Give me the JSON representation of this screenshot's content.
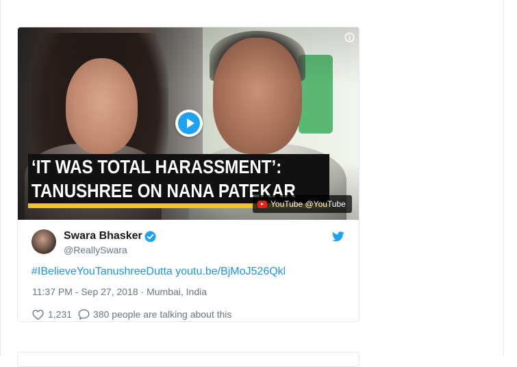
{
  "video": {
    "headline_line1": "‘IT WAS TOTAL HARASSMENT’:",
    "headline_line2": "TANUSHREE ON NANA PATEKAR",
    "attribution": "YouTube @YouTube",
    "info_icon": "info-icon",
    "play_icon": "play-icon"
  },
  "tweet": {
    "author_name": "Swara Bhasker",
    "author_handle": "@ReallySwara",
    "verified_icon": "verified-badge-icon",
    "platform_icon": "twitter-bird-icon",
    "hashtag": "#IBelieveYouTanushreeDutta",
    "link": "youtu.be/BjMoJ526Qkl",
    "time": "11:37 PM - Sep 27, 2018",
    "separator": " · ",
    "location": "Mumbai, India",
    "like_count": "1,231",
    "talking_text": "380 people are talking about this"
  },
  "colors": {
    "link_blue": "#1b95e0",
    "brand_blue": "#1da1f2",
    "muted_text": "#657786",
    "banner_yellow": "#f2c12e"
  }
}
